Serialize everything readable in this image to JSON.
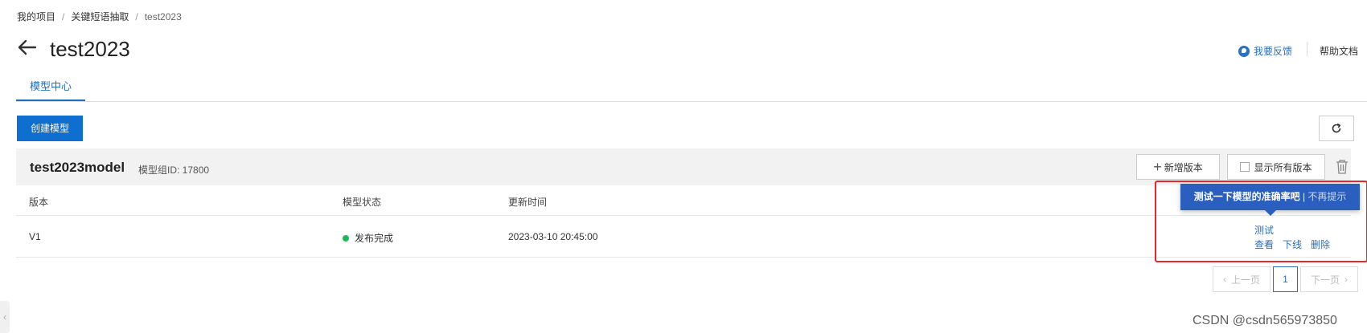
{
  "breadcrumb": {
    "items": [
      "我的项目",
      "关键短语抽取",
      "test2023"
    ],
    "separator": "/"
  },
  "header": {
    "title": "test2023",
    "feedback_label": "我要反馈",
    "help_label": "帮助文档"
  },
  "tabs": [
    {
      "label": "模型中心",
      "active": true
    }
  ],
  "toolbar": {
    "create_label": "创建模型"
  },
  "model_group": {
    "name": "test2023model",
    "id_label": "模型组ID: 17800",
    "add_version_label": "新增版本",
    "show_all_label": "显示所有版本"
  },
  "table": {
    "columns": [
      "版本",
      "模型状态",
      "更新时间"
    ],
    "rows": [
      {
        "version": "V1",
        "status": "发布完成",
        "updated": "2023-03-10 20:45:00",
        "actions": [
          "测试",
          "查看",
          "下线",
          "删除"
        ]
      }
    ]
  },
  "tooltip": {
    "message": "测试一下模型的准确率吧",
    "separator": "|",
    "dismiss": "不再提示"
  },
  "pagination": {
    "prev_label": "上一页",
    "current_page": "1",
    "next_label": "下一页"
  },
  "watermark": "CSDN @csdn565973850",
  "colors": {
    "primary": "#0f6fd1",
    "link": "#2a6ebb",
    "status_success": "#1db85a",
    "tooltip_bg": "#2a5fbf",
    "highlight": "#e8262d"
  }
}
